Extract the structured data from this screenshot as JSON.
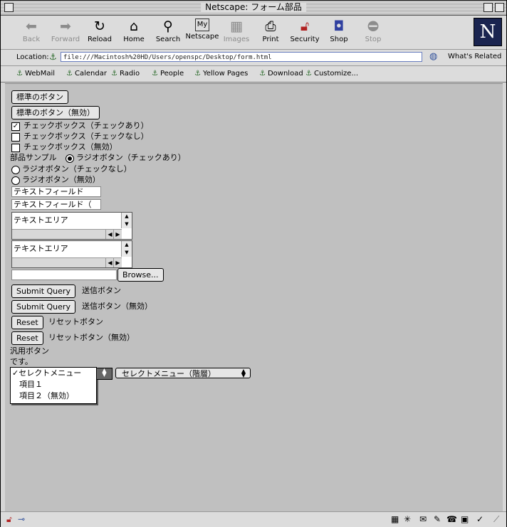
{
  "window": {
    "title": "Netscape: フォーム部品"
  },
  "toolbar": {
    "buttons": [
      {
        "label": "Back",
        "icon": "back-arrow",
        "enabled": false
      },
      {
        "label": "Forward",
        "icon": "forward-arrow",
        "enabled": false
      },
      {
        "label": "Reload",
        "icon": "reload",
        "enabled": true
      },
      {
        "label": "Home",
        "icon": "home",
        "enabled": true
      },
      {
        "label": "Search",
        "icon": "search",
        "enabled": true
      },
      {
        "label": "Netscape",
        "icon": "my-netscape",
        "enabled": true
      },
      {
        "label": "Images",
        "icon": "images",
        "enabled": false
      },
      {
        "label": "Print",
        "icon": "printer",
        "enabled": true
      },
      {
        "label": "Security",
        "icon": "lock",
        "enabled": true
      },
      {
        "label": "Shop",
        "icon": "shopping-bag",
        "enabled": true
      },
      {
        "label": "Stop",
        "icon": "stop",
        "enabled": false
      }
    ],
    "logo": "N"
  },
  "location": {
    "label": "Location:",
    "url": "file:///Macintosh%20HD/Users/openspc/Desktop/form.html",
    "related": "What's Related"
  },
  "personal": {
    "items": [
      "WebMail",
      "Calendar",
      "Radio",
      "People",
      "Yellow Pages",
      "Download",
      "Customize..."
    ]
  },
  "form": {
    "btn_standard": "標準のボタン",
    "btn_disabled": "標準のボタン（無効）",
    "check1": "チェックボックス（チェックあり）",
    "check2": "チェックボックス（チェックなし）",
    "check3": "チェックボックス（無効）",
    "radio_prefix": "部品サンプル",
    "radio1": "ラジオボタン（チェックあり）",
    "radio2": "ラジオボタン（チェックなし）",
    "radio3": "ラジオボタン（無効）",
    "textfield1": "テキストフィールド",
    "textfield2": "テキストフィールド（",
    "textarea1": "テキストエリア",
    "textarea2": "テキストエリア",
    "file_value": "",
    "browse": "Browse...",
    "submit1": "Submit Query",
    "submit1_label": "送信ボタン",
    "submit2": "Submit Query",
    "submit2_label": "送信ボタン（無効）",
    "reset1": "Reset",
    "reset1_label": "リセットボタン",
    "reset2": "Reset",
    "reset2_label": "リセットボタン（無効）",
    "generic_line1": "汎用ボタン",
    "generic_line2": "です。",
    "select_menu": {
      "selected": "セレクトメニュー",
      "options": [
        "セレクトメニュー",
        "項目１",
        "項目２（無効）"
      ]
    },
    "select_hier": "セレクトメニュー（階層）"
  }
}
